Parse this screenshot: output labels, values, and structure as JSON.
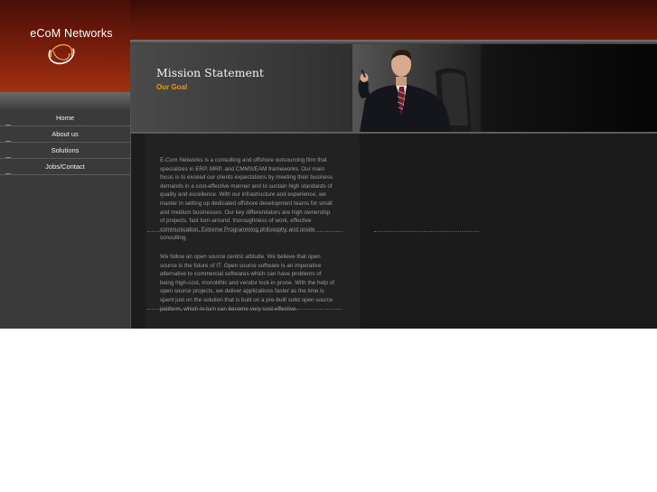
{
  "brand": {
    "name": "eCoM Networks",
    "logo_icon": "swirl-rings-icon",
    "accent": "#e59a12",
    "band": "#5a140a"
  },
  "nav": {
    "items": [
      {
        "label": "Home"
      },
      {
        "label": "About us"
      },
      {
        "label": "Solutions"
      },
      {
        "label": "Jobs/Contact"
      }
    ]
  },
  "header": {
    "title": "Mission Statement",
    "subtitle": "Our Goal",
    "photo_icon": "businessman-photo"
  },
  "content": {
    "para1": "E-Com Networks is a consulting and offshore outsourcing firm that specializes in ERP, MRP, and CMMS/EAM frameworks. Our main focus is to exceed our clients expectations by meeting their business demands in a cost-effective manner and to sustain high standards of quality and excellence. With our infrastructure and experience, we master in setting up dedicated offshore development teams for small and medium businesses. Our key differentiators are high ownership of projects, fast turn-around, thoroughness of work, effective communication, Extreme Programming philosophy and onsite consulting.",
    "para2": "We follow an open source centric attitude. We believe that open source is the future of IT. Open source software is an imperative alternative to commercial softwares which can have problems of being high-cost, monolithic and vendor lock-in prone. With the help of open source projects, we deliver applications faster as the time is spent just on the solution that is built on a pre-built solid open source platform, which in-turn can become very cost-effective."
  }
}
